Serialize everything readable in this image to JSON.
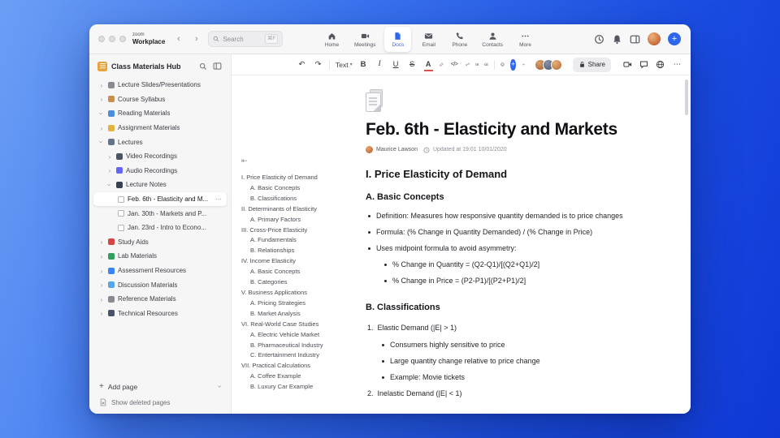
{
  "colors": {
    "accent": "#2E66EC",
    "window_bg": "#FFFFFF",
    "sidebar_bg": "#F6F6F7",
    "desktop_blue": "#2B63EA"
  },
  "titlebar": {
    "brand_top": "zoom",
    "brand_bottom": "Workplace",
    "search_placeholder": "Search",
    "search_shortcut": "⌘F",
    "tabs": [
      {
        "label": "Home",
        "icon": "home-icon",
        "active": false
      },
      {
        "label": "Meetings",
        "icon": "video-camera-icon",
        "active": false
      },
      {
        "label": "Docs",
        "icon": "document-icon",
        "active": true
      },
      {
        "label": "Email",
        "icon": "envelope-icon",
        "active": false
      },
      {
        "label": "Phone",
        "icon": "phone-icon",
        "active": false
      },
      {
        "label": "Contacts",
        "icon": "person-icon",
        "active": false
      },
      {
        "label": "More",
        "icon": "ellipsis-icon",
        "active": false
      }
    ]
  },
  "sidebar": {
    "title": "Class Materials Hub",
    "items": [
      {
        "label": "Lecture Slides/Presentations",
        "icon": "projector",
        "level": 0,
        "expanded": false
      },
      {
        "label": "Course Syllabus",
        "icon": "clipboard",
        "level": 0,
        "expanded": false
      },
      {
        "label": "Reading Materials",
        "icon": "open-book",
        "level": 0,
        "expanded": true
      },
      {
        "label": "Assignment Materials",
        "icon": "memo",
        "level": 0,
        "expanded": false
      },
      {
        "label": "Lectures",
        "icon": "tag",
        "level": 0,
        "expanded": true
      },
      {
        "label": "Video Recordings",
        "icon": "video-camera",
        "level": 1,
        "expanded": false
      },
      {
        "label": "Audio Recordings",
        "icon": "headphones",
        "level": 1,
        "expanded": false
      },
      {
        "label": "Lecture Notes",
        "icon": "notebook",
        "level": 1,
        "expanded": true
      },
      {
        "label": "Feb. 6th - Elasticity and M...",
        "icon": "page",
        "level": 2,
        "selected": true
      },
      {
        "label": "Jan. 30th - Markets and P...",
        "icon": "page",
        "level": 2,
        "selected": false
      },
      {
        "label": "Jan. 23rd - Intro to Econo...",
        "icon": "page",
        "level": 2,
        "selected": false
      },
      {
        "label": "Study Aids",
        "icon": "red-book",
        "level": 0,
        "expanded": false
      },
      {
        "label": "Lab Materials",
        "icon": "pencil",
        "level": 0,
        "expanded": false
      },
      {
        "label": "Assessment Resources",
        "icon": "bar-chart",
        "level": 0,
        "expanded": false
      },
      {
        "label": "Discussion Materials",
        "icon": "speech-bubble",
        "level": 0,
        "expanded": false
      },
      {
        "label": "Reference Materials",
        "icon": "paperclip",
        "level": 0,
        "expanded": false
      },
      {
        "label": "Technical Resources",
        "icon": "toolbox",
        "level": 0,
        "expanded": false
      }
    ],
    "add_page_label": "Add page",
    "show_deleted_label": "Show deleted pages"
  },
  "doc_toolbar": {
    "text_style_label": "Text",
    "share_label": "Share"
  },
  "document": {
    "title": "Feb. 6th - Elasticity and Markets",
    "author": "Maurice Lawson",
    "updated": "Updated at 19:01 10/01/2020",
    "outline": [
      {
        "label": "I. Price Elasticity of Demand",
        "level": 0
      },
      {
        "label": "A. Basic Concepts",
        "level": 1
      },
      {
        "label": "B. Classifications",
        "level": 1
      },
      {
        "label": "II. Determinants of Elasticity",
        "level": 0
      },
      {
        "label": "A. Primary Factors",
        "level": 1
      },
      {
        "label": "III. Cross-Price Elasticity",
        "level": 0
      },
      {
        "label": "A. Fundamentals",
        "level": 1
      },
      {
        "label": "B. Relationships",
        "level": 1
      },
      {
        "label": "IV. Income Elasticity",
        "level": 0
      },
      {
        "label": "A. Basic Concepts",
        "level": 1
      },
      {
        "label": "B. Categories",
        "level": 1
      },
      {
        "label": "V. Business Applications",
        "level": 0
      },
      {
        "label": "A. Pricing Strategies",
        "level": 1
      },
      {
        "label": "B. Market Analysis",
        "level": 1
      },
      {
        "label": "VI. Real-World Case Studies",
        "level": 0
      },
      {
        "label": "A. Electric Vehicle Market",
        "level": 1
      },
      {
        "label": "B. Pharmaceutical Industry",
        "level": 1
      },
      {
        "label": "C. Entertainment Industry",
        "level": 1
      },
      {
        "label": "VII. Practical Calculations",
        "level": 0
      },
      {
        "label": "A. Coffee Example",
        "level": 1
      },
      {
        "label": "B. Luxury Car Example",
        "level": 1
      }
    ],
    "body": {
      "h1": "I. Price Elasticity of Demand",
      "hA": "A. Basic Concepts",
      "bullets_a": [
        "Definition: Measures how responsive quantity demanded is to price changes",
        "Formula: (% Change in Quantity Demanded) / (% Change in Price)",
        "Uses midpoint formula to avoid asymmetry:"
      ],
      "bullets_a_nested": [
        "% Change in Quantity = (Q2-Q1)/[(Q2+Q1)/2]",
        "% Change in Price = (P2-P1)/[(P2+P1)/2]"
      ],
      "hB": "B. Classifications",
      "list_b": [
        {
          "marker": "1.",
          "text": "Elastic Demand (|E| > 1)"
        },
        {
          "marker": "2.",
          "text": "Inelastic Demand (|E| < 1)"
        }
      ],
      "list_b_item1_bullets": [
        "Consumers highly sensitive to price",
        "Large quantity change relative to price change",
        "Example: Movie tickets"
      ]
    }
  }
}
